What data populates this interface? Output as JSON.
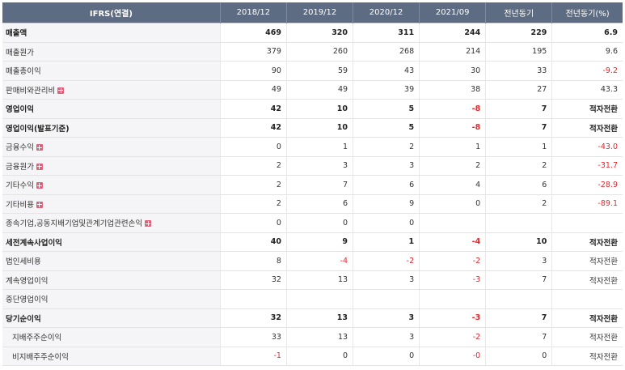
{
  "header": {
    "label": "IFRS(연결)",
    "columns": [
      "2018/12",
      "2019/12",
      "2020/12",
      "2021/09",
      "전년동기",
      "전년동기(%)"
    ]
  },
  "rows": [
    {
      "label": "매출액",
      "bold": true,
      "expand": false,
      "values": [
        "469",
        "320",
        "311",
        "244",
        "229",
        "6.9"
      ]
    },
    {
      "label": "매출원가",
      "bold": false,
      "expand": false,
      "values": [
        "379",
        "260",
        "268",
        "214",
        "195",
        "9.6"
      ]
    },
    {
      "label": "매출총이익",
      "bold": false,
      "expand": false,
      "values": [
        "90",
        "59",
        "43",
        "30",
        "33",
        "-9.2"
      ]
    },
    {
      "label": "판매비와관리비",
      "bold": false,
      "expand": true,
      "values": [
        "49",
        "49",
        "39",
        "38",
        "27",
        "43.3"
      ]
    },
    {
      "label": "영업이익",
      "bold": true,
      "expand": false,
      "values": [
        "42",
        "10",
        "5",
        "-8",
        "7",
        "적자전환"
      ]
    },
    {
      "label": "영업이익(발표기준)",
      "bold": true,
      "expand": false,
      "values": [
        "42",
        "10",
        "5",
        "-8",
        "7",
        "적자전환"
      ]
    },
    {
      "label": "금융수익",
      "bold": false,
      "expand": true,
      "values": [
        "0",
        "1",
        "2",
        "1",
        "1",
        "-43.0"
      ]
    },
    {
      "label": "금융원가",
      "bold": false,
      "expand": true,
      "values": [
        "2",
        "3",
        "3",
        "2",
        "2",
        "-31.7"
      ]
    },
    {
      "label": "기타수익",
      "bold": false,
      "expand": true,
      "values": [
        "2",
        "7",
        "6",
        "4",
        "6",
        "-28.9"
      ]
    },
    {
      "label": "기타비용",
      "bold": false,
      "expand": true,
      "values": [
        "2",
        "6",
        "9",
        "0",
        "2",
        "-89.1"
      ]
    },
    {
      "label": "종속기업,공동지배기업및관계기업관련손익",
      "bold": false,
      "expand": true,
      "values": [
        "0",
        "0",
        "0",
        "",
        "",
        ""
      ]
    },
    {
      "label": "세전계속사업이익",
      "bold": true,
      "expand": false,
      "values": [
        "40",
        "9",
        "1",
        "-4",
        "10",
        "적자전환"
      ]
    },
    {
      "label": "법인세비용",
      "bold": false,
      "expand": false,
      "values": [
        "8",
        "-4",
        "-2",
        "-2",
        "3",
        "적자전환"
      ]
    },
    {
      "label": "계속영업이익",
      "bold": false,
      "expand": false,
      "values": [
        "32",
        "13",
        "3",
        "-3",
        "7",
        "적자전환"
      ]
    },
    {
      "label": "중단영업이익",
      "bold": false,
      "expand": false,
      "values": [
        "",
        "",
        "",
        "",
        "",
        ""
      ]
    },
    {
      "label": "당기순이익",
      "bold": true,
      "expand": false,
      "values": [
        "32",
        "13",
        "3",
        "-3",
        "7",
        "적자전환"
      ]
    },
    {
      "label": "지배주주순이익",
      "bold": false,
      "expand": false,
      "indent": true,
      "values": [
        "33",
        "13",
        "3",
        "-2",
        "7",
        "적자전환"
      ]
    },
    {
      "label": "비지배주주순이익",
      "bold": false,
      "expand": false,
      "indent": true,
      "values": [
        "-1",
        "0",
        "0",
        "-0",
        "0",
        "적자전환"
      ]
    }
  ]
}
